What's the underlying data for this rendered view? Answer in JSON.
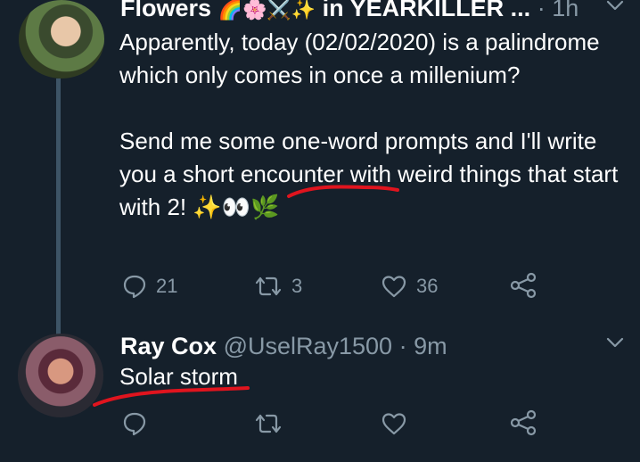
{
  "tweet1": {
    "name": "Flowers",
    "name_emoji": "🌈🌸⚔️✨",
    "context": "in YEARKILLER ...",
    "separator": "·",
    "time": "1h",
    "paragraph1": "Apparently, today (02/02/2020) is a palindrome which only comes in once a millenium?",
    "paragraph2": "Send me some one-word prompts and I'll write you a short encounter with weird things that start with 2! ✨👀🌿",
    "reply_count": "21",
    "retweet_count": "3",
    "like_count": "36"
  },
  "tweet2": {
    "name": "Ray Cox",
    "handle": "@UselRay1500",
    "separator": "·",
    "time": "9m",
    "text": "Solar storm"
  },
  "icons": {
    "caret": "chevron-down-icon",
    "reply": "reply-icon",
    "retweet": "retweet-icon",
    "like": "heart-icon",
    "share": "share-icon"
  },
  "colors": {
    "background": "#15202b",
    "muted": "#8899a6",
    "thread_line": "#3d5466",
    "scribble": "#e0141e"
  }
}
